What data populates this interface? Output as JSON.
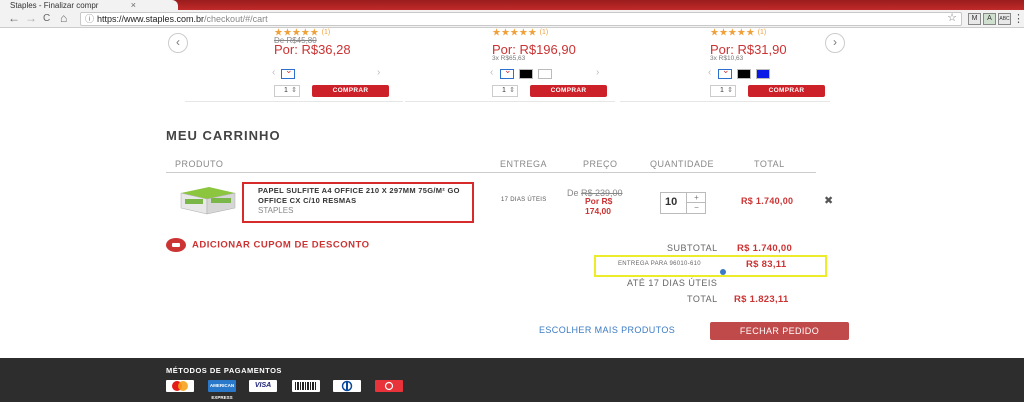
{
  "browser": {
    "tab_title": "Staples - Finalizar compr",
    "tab_close": "×",
    "url_host": "https://www.staples.com.br",
    "url_path": "/checkout/#/cart",
    "back": "←",
    "forward": "→",
    "reload": "C",
    "home": "⌂",
    "menu": "⋮",
    "extensions": [
      "M",
      "A",
      "ABC"
    ]
  },
  "carousel": {
    "prev": "‹",
    "next": "›",
    "cards": [
      {
        "stars": "★★★★★",
        "count": "(1)",
        "old_price": "De R$45,80",
        "price": "Por: R$36,28",
        "installments": "",
        "qty": "1",
        "buy_label": "COMPRAR"
      },
      {
        "stars": "★★★★★",
        "count": "(1)",
        "old_price": "",
        "price": "Por: R$196,90",
        "installments": "3x R$65,63",
        "qty": "1",
        "buy_label": "COMPRAR"
      },
      {
        "stars": "★★★★★",
        "count": "(1)",
        "old_price": "",
        "price": "Por: R$31,90",
        "installments": "3x R$10,63",
        "qty": "1",
        "buy_label": "COMPRAR"
      }
    ],
    "swatch_colors": {
      "black": "#000000",
      "white": "#ffffff",
      "blue": "#0a19e6"
    }
  },
  "cart": {
    "title": "MEU CARRINHO",
    "columns": {
      "product": "PRODUTO",
      "delivery": "ENTREGA",
      "price": "PREÇO",
      "quantity": "QUANTIDADE",
      "total": "TOTAL"
    },
    "item": {
      "name": "PAPEL SULFITE A4 OFFICE 210 X 297MM 75G/M² GO OFFICE CX C/10 RESMAS",
      "brand": "STAPLES",
      "delivery": "17 DIAS ÚTEIS",
      "price_was_prefix": "De",
      "price_was": "R$ 239,00",
      "price_now": "Por R$ 174,00",
      "quantity": "10",
      "inc": "+",
      "dec": "−",
      "total": "R$ 1.740,00",
      "remove": "✖"
    },
    "coupon_label": "ADICIONAR CUPOM DE DESCONTO",
    "summary": {
      "subtotal_label": "SUBTOTAL",
      "subtotal_value": "R$ 1.740,00",
      "shipping_label": "ENTREGA PARA 96010-610",
      "shipping_value": "R$ 83,11",
      "eta_label": "ATÉ 17 DIAS ÚTEIS",
      "total_label": "TOTAL",
      "total_value": "R$ 1.823,11"
    },
    "more_products": "ESCOLHER MAIS PRODUTOS",
    "checkout": "FECHAR PEDIDO"
  },
  "footer": {
    "payment_title": "MÉTODOS DE PAGAMENTOS",
    "methods": [
      "mastercard-icon",
      "amex-icon",
      "visa-icon",
      "boleto-icon",
      "diners-icon",
      "hipercard-icon"
    ],
    "visa_text": "VISA"
  },
  "colors": {
    "brand_red": "#cc2129",
    "price_red": "#cc3333",
    "highlight_red_box": "#d72a2a",
    "highlight_yellow_box": "#ecec2a",
    "link_blue": "#3c7bc4",
    "footer_bg": "#2d2d2d"
  }
}
